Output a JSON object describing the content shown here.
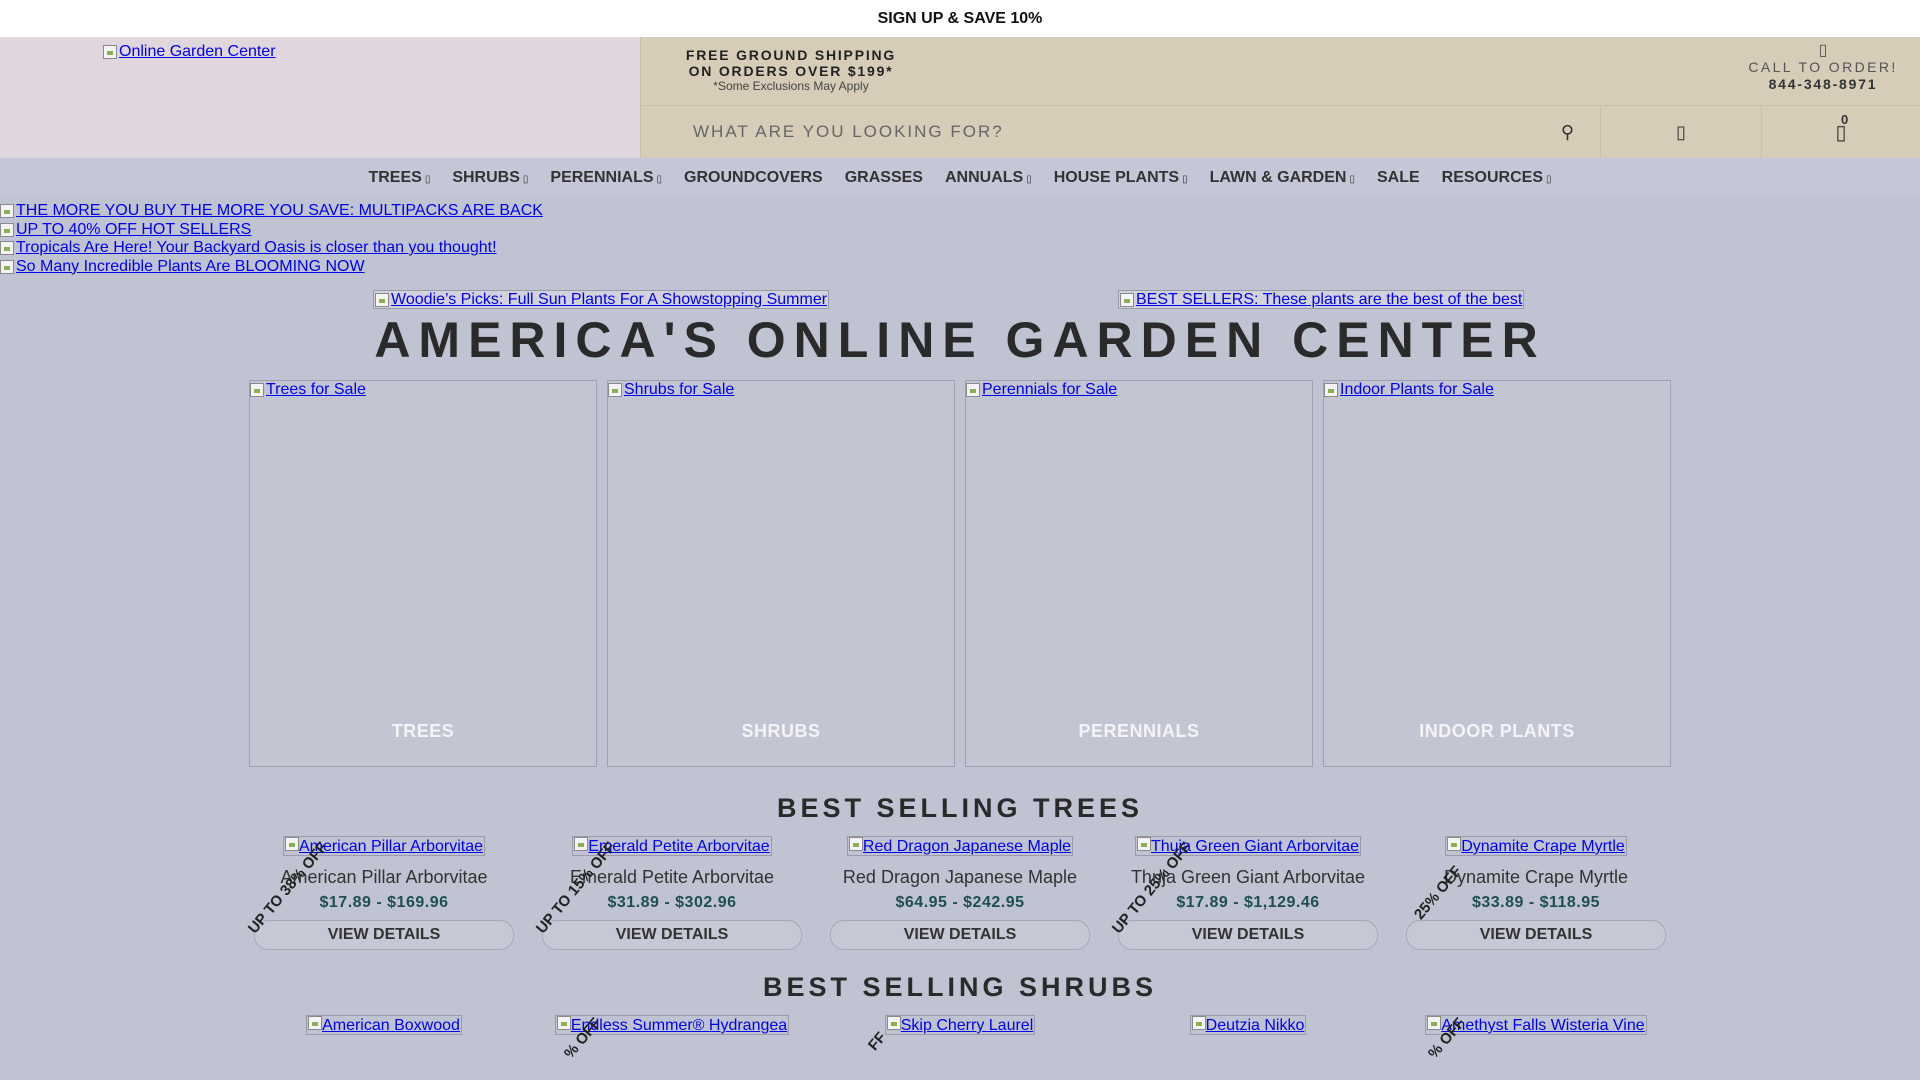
{
  "topbar": {
    "text": "SIGN UP & SAVE 10%"
  },
  "header": {
    "logo_alt": "Online Garden Center",
    "shipping_line1": "FREE GROUND SHIPPING",
    "shipping_line2": "ON ORDERS OVER $199*",
    "shipping_note": "*Some Exclusions May Apply",
    "call_label": "CALL TO ORDER!",
    "phone": "844-348-8971",
    "search_placeholder": "WHAT ARE YOU LOOKING FOR?",
    "cart_count": "0"
  },
  "nav": [
    {
      "label": "TREES",
      "dropdown": true
    },
    {
      "label": "SHRUBS",
      "dropdown": true
    },
    {
      "label": "PERENNIALS",
      "dropdown": true
    },
    {
      "label": "GROUNDCOVERS",
      "dropdown": false
    },
    {
      "label": "GRASSES",
      "dropdown": false
    },
    {
      "label": "ANNUALS",
      "dropdown": true
    },
    {
      "label": "HOUSE PLANTS",
      "dropdown": true
    },
    {
      "label": "LAWN & GARDEN",
      "dropdown": true
    },
    {
      "label": "SALE",
      "dropdown": false
    },
    {
      "label": "RESOURCES",
      "dropdown": true
    }
  ],
  "promos": [
    "THE MORE YOU BUY THE MORE YOU SAVE: MULTIPACKS ARE BACK",
    "UP TO 40% OFF HOT SELLERS",
    "Tropicals Are Here! Your Backyard Oasis is closer than you thought!",
    "So Many Incredible Plants Are BLOOMING NOW"
  ],
  "features": {
    "left": "Woodie’s Picks: Full Sun Plants For A Showstopping Summer",
    "right": "BEST SELLERS: These plants are the best of the best"
  },
  "hero_title": "AMERICA'S ONLINE GARDEN CENTER",
  "categories": [
    {
      "alt": "Trees for Sale",
      "label": "TREES"
    },
    {
      "alt": "Shrubs for Sale",
      "label": "SHRUBS"
    },
    {
      "alt": "Perennials for Sale",
      "label": "PERENNIALS"
    },
    {
      "alt": "Indoor Plants for Sale",
      "label": "INDOOR PLANTS"
    }
  ],
  "best_trees": {
    "title": "BEST SELLING TREES",
    "button_label": "VIEW DETAILS",
    "items": [
      {
        "name": "American Pillar Arborvitae",
        "price": "$17.89 - $169.96",
        "badge": "UP TO 38% OFF"
      },
      {
        "name": "Emerald Petite Arborvitae",
        "price": "$31.89 - $302.96",
        "badge": "UP TO 15% OFF"
      },
      {
        "name": "Red Dragon Japanese Maple",
        "price": "$64.95 - $242.95",
        "badge": ""
      },
      {
        "name": "Thuja Green Giant Arborvitae",
        "price": "$17.89 - $1,129.46",
        "badge": "UP TO 25% OFF"
      },
      {
        "name": "Dynamite Crape Myrtle",
        "price": "$33.89 - $118.95",
        "badge": "25% OFF"
      }
    ]
  },
  "best_shrubs": {
    "title": "BEST SELLING SHRUBS",
    "items": [
      {
        "name": "American Boxwood",
        "badge": ""
      },
      {
        "name": "Endless Summer® Hydrangea",
        "badge": "% OFF"
      },
      {
        "name": "Skip Cherry Laurel",
        "badge": "FF"
      },
      {
        "name": "Deutzia Nikko",
        "badge": ""
      },
      {
        "name": "Amethyst Falls Wisteria Vine",
        "badge": "% OFF"
      }
    ]
  }
}
